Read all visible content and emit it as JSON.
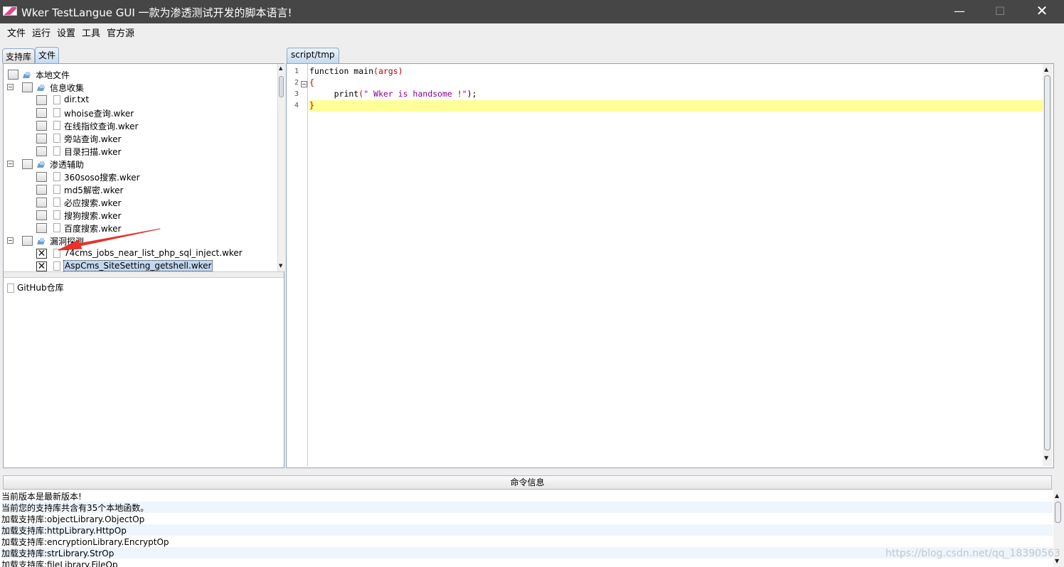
{
  "window": {
    "title": "Wker TestLangue GUI   一款为渗透测试开发的脚本语言!",
    "minimize": "—",
    "maximize": "☐",
    "close": "✕"
  },
  "menu": [
    "文件",
    "运行",
    "设置",
    "工具",
    "官方源"
  ],
  "left_tabs": [
    "支持库",
    "文件"
  ],
  "tree": {
    "root": "本地文件",
    "groups": [
      {
        "label": "信息收集",
        "files": [
          "dir.txt",
          "whoise查询.wker",
          "在线指纹查询.wker",
          "旁站查询.wker",
          "目录扫描.wker"
        ]
      },
      {
        "label": "渗透辅助",
        "files": [
          "360soso搜索.wker",
          "md5解密.wker",
          "必应搜索.wker",
          "搜狗搜索.wker",
          "百度搜索.wker"
        ]
      },
      {
        "label": "漏洞探测",
        "files": [
          "74cms_jobs_near_list_php_sql_inject.wker",
          "AspCms_SiteSetting_getshell.wker"
        ]
      }
    ]
  },
  "bottom_list": [
    "GitHub仓库"
  ],
  "editor": {
    "tab": "script/tmp",
    "line_numbers": [
      "1",
      "2",
      "3",
      "4"
    ],
    "lines": {
      "l1_kw": "function main",
      "l1_paren": "(args)",
      "l2": "{",
      "l3_indent": "     print",
      "l3_open": "(",
      "l3_str": "\" Wker is handsome !\"",
      "l3_close": ");",
      "l4": "}"
    }
  },
  "command_info": {
    "header": "命令信息",
    "lines": [
      "当前版本是最新版本!",
      "当前您的支持库共含有35个本地函数。",
      "加载支持库:objectLibrary.ObjectOp",
      "加载支持库:httpLibrary.HttpOp",
      "加载支持库:encryptionLibrary.EncryptOp",
      "加载支持库:strLibrary.StrOp",
      "加载支持库:fileLibrary.FileOp"
    ]
  },
  "watermark": "https://blog.csdn.net/qq_18390563",
  "colors": {
    "titlebar": "#464646",
    "current_line": "#ffff99",
    "annotation_arrow": "#e8322c"
  }
}
